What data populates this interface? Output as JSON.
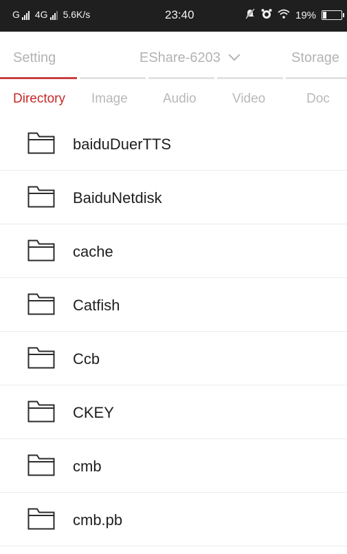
{
  "status_bar": {
    "network_1": "G",
    "network_2": "4G",
    "speed": "5.6K/s",
    "time": "23:40",
    "battery": "19%",
    "battery_level": 0.19
  },
  "top_tabs": {
    "setting": "Setting",
    "device": "EShare-6203",
    "storage": "Storage"
  },
  "category_tabs": [
    "Directory",
    "Image",
    "Audio",
    "Video",
    "Doc"
  ],
  "active_category": "Directory",
  "files": [
    {
      "name": "baiduDuerTTS"
    },
    {
      "name": "BaiduNetdisk"
    },
    {
      "name": "cache"
    },
    {
      "name": "Catfish"
    },
    {
      "name": "Ccb"
    },
    {
      "name": "CKEY"
    },
    {
      "name": "cmb"
    },
    {
      "name": "cmb.pb"
    }
  ],
  "colors": {
    "accent": "#c62828",
    "inactive_text": "#b8b8b8",
    "status_bar_bg": "#1f1f1f"
  },
  "icons": {
    "folder": "folder-icon",
    "dropdown": "chevron-down-icon",
    "mute": "mute-icon",
    "alarm": "alarm-icon",
    "wifi": "wifi-icon",
    "battery": "battery-icon",
    "signal": "signal-icon"
  }
}
